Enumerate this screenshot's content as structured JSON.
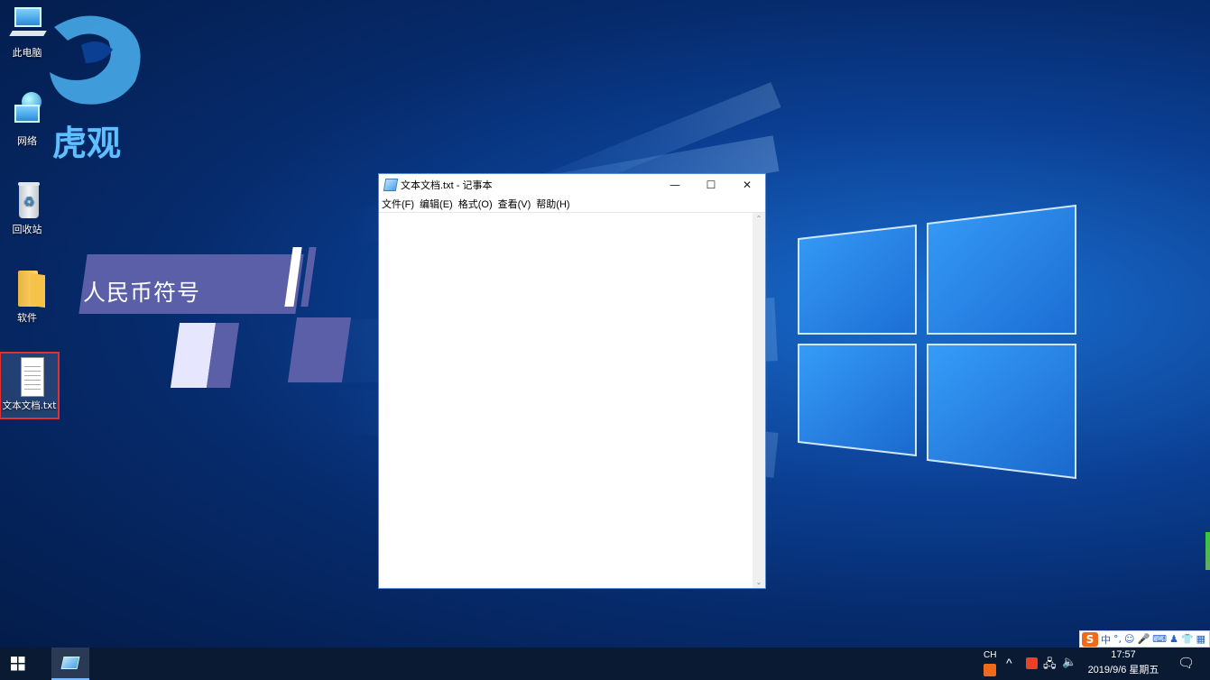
{
  "desktop": {
    "icons": [
      {
        "label": "此电脑"
      },
      {
        "label": "网络"
      },
      {
        "label": "回收站"
      },
      {
        "label": "软件"
      },
      {
        "label": "文本文档.txt"
      }
    ]
  },
  "overlay": {
    "logo_text": "虎观",
    "banner_text": "人民币符号"
  },
  "notepad": {
    "title": "文本文档.txt - 记事本",
    "controls": {
      "minimize": "—",
      "maximize": "☐",
      "close": "✕"
    },
    "menu": [
      "文件(F)",
      "编辑(E)",
      "格式(O)",
      "查看(V)",
      "帮助(H)"
    ],
    "content": ""
  },
  "ime": {
    "logo": "S",
    "mode": "中",
    "punct": "°,"
  },
  "taskbar": {
    "lang": "CH",
    "time": "17:57",
    "date": "2019/9/6 星期五"
  },
  "colors": {
    "taskbar": "#0a1a33",
    "banner": "#5a5fa8",
    "selection": "#e03030",
    "ime_brand": "#f06a1a"
  }
}
